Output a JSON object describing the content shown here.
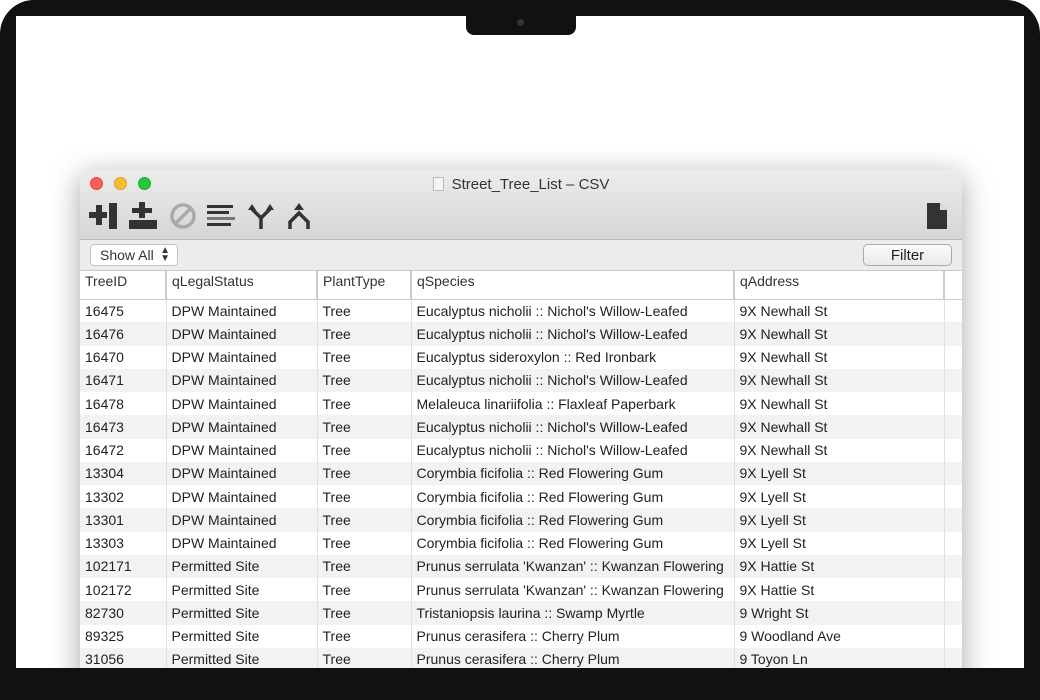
{
  "window": {
    "title": "Street_Tree_List – CSV"
  },
  "toolbar": {
    "icons": [
      "add-column-icon",
      "add-row-icon",
      "disable-icon",
      "align-icon",
      "split-icon",
      "merge-icon",
      "document-icon"
    ]
  },
  "filterbar": {
    "select_value": "Show All",
    "filter_label": "Filter"
  },
  "table": {
    "headers": [
      "TreeID",
      "qLegalStatus",
      "PlantType",
      "qSpecies",
      "qAddress"
    ],
    "rows": [
      [
        "16475",
        "DPW Maintained",
        "Tree",
        "Eucalyptus nicholii :: Nichol's Willow-Leafed",
        "9X Newhall St"
      ],
      [
        "16476",
        "DPW Maintained",
        "Tree",
        "Eucalyptus nicholii :: Nichol's Willow-Leafed",
        "9X Newhall St"
      ],
      [
        "16470",
        "DPW Maintained",
        "Tree",
        "Eucalyptus sideroxylon :: Red Ironbark",
        "9X Newhall St"
      ],
      [
        "16471",
        "DPW Maintained",
        "Tree",
        "Eucalyptus nicholii :: Nichol's Willow-Leafed",
        "9X Newhall St"
      ],
      [
        "16478",
        "DPW Maintained",
        "Tree",
        "Melaleuca linariifolia :: Flaxleaf Paperbark",
        "9X Newhall St"
      ],
      [
        "16473",
        "DPW Maintained",
        "Tree",
        "Eucalyptus nicholii :: Nichol's Willow-Leafed",
        "9X Newhall St"
      ],
      [
        "16472",
        "DPW Maintained",
        "Tree",
        "Eucalyptus nicholii :: Nichol's Willow-Leafed",
        "9X Newhall St"
      ],
      [
        "13304",
        "DPW Maintained",
        "Tree",
        "Corymbia ficifolia :: Red Flowering Gum",
        "9X Lyell St"
      ],
      [
        "13302",
        "DPW Maintained",
        "Tree",
        "Corymbia ficifolia :: Red Flowering Gum",
        "9X Lyell St"
      ],
      [
        "13301",
        "DPW Maintained",
        "Tree",
        "Corymbia ficifolia :: Red Flowering Gum",
        "9X Lyell St"
      ],
      [
        "13303",
        "DPW Maintained",
        "Tree",
        "Corymbia ficifolia :: Red Flowering Gum",
        "9X Lyell St"
      ],
      [
        "102171",
        "Permitted Site",
        "Tree",
        "Prunus serrulata 'Kwanzan' :: Kwanzan Flowering",
        "9X Hattie St"
      ],
      [
        "102172",
        "Permitted Site",
        "Tree",
        "Prunus serrulata 'Kwanzan' :: Kwanzan Flowering",
        "9X Hattie St"
      ],
      [
        "82730",
        "Permitted Site",
        "Tree",
        "Tristaniopsis laurina :: Swamp Myrtle",
        "9 Wright St"
      ],
      [
        "89325",
        "Permitted Site",
        "Tree",
        "Prunus cerasifera :: Cherry Plum",
        "9 Woodland Ave"
      ],
      [
        "31056",
        "Permitted Site",
        "Tree",
        "Prunus cerasifera :: Cherry Plum",
        "9 Toyon Ln"
      ]
    ]
  }
}
